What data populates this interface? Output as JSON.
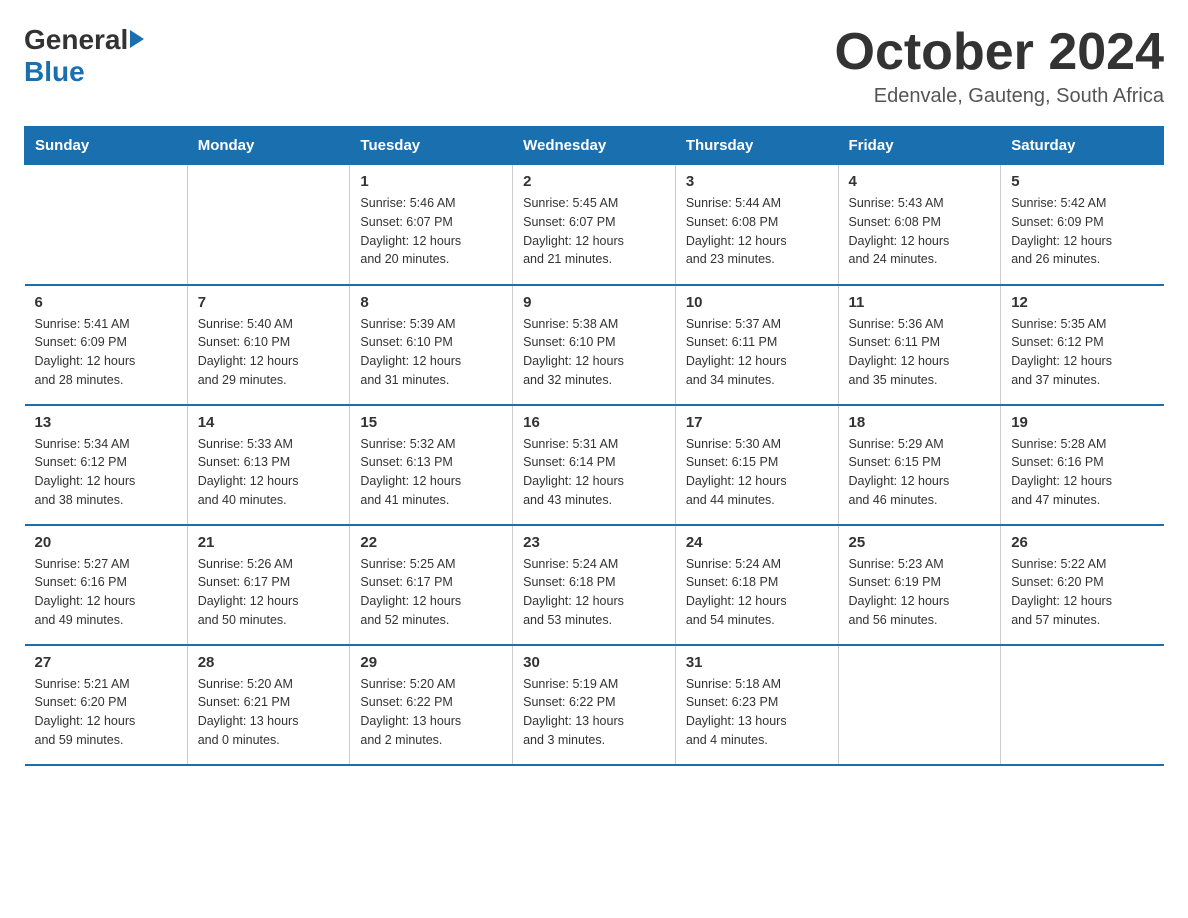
{
  "header": {
    "logo_general": "General",
    "logo_blue": "Blue",
    "month_title": "October 2024",
    "location": "Edenvale, Gauteng, South Africa"
  },
  "calendar": {
    "days_of_week": [
      "Sunday",
      "Monday",
      "Tuesday",
      "Wednesday",
      "Thursday",
      "Friday",
      "Saturday"
    ],
    "weeks": [
      [
        {
          "day": "",
          "info": ""
        },
        {
          "day": "",
          "info": ""
        },
        {
          "day": "1",
          "info": "Sunrise: 5:46 AM\nSunset: 6:07 PM\nDaylight: 12 hours\nand 20 minutes."
        },
        {
          "day": "2",
          "info": "Sunrise: 5:45 AM\nSunset: 6:07 PM\nDaylight: 12 hours\nand 21 minutes."
        },
        {
          "day": "3",
          "info": "Sunrise: 5:44 AM\nSunset: 6:08 PM\nDaylight: 12 hours\nand 23 minutes."
        },
        {
          "day": "4",
          "info": "Sunrise: 5:43 AM\nSunset: 6:08 PM\nDaylight: 12 hours\nand 24 minutes."
        },
        {
          "day": "5",
          "info": "Sunrise: 5:42 AM\nSunset: 6:09 PM\nDaylight: 12 hours\nand 26 minutes."
        }
      ],
      [
        {
          "day": "6",
          "info": "Sunrise: 5:41 AM\nSunset: 6:09 PM\nDaylight: 12 hours\nand 28 minutes."
        },
        {
          "day": "7",
          "info": "Sunrise: 5:40 AM\nSunset: 6:10 PM\nDaylight: 12 hours\nand 29 minutes."
        },
        {
          "day": "8",
          "info": "Sunrise: 5:39 AM\nSunset: 6:10 PM\nDaylight: 12 hours\nand 31 minutes."
        },
        {
          "day": "9",
          "info": "Sunrise: 5:38 AM\nSunset: 6:10 PM\nDaylight: 12 hours\nand 32 minutes."
        },
        {
          "day": "10",
          "info": "Sunrise: 5:37 AM\nSunset: 6:11 PM\nDaylight: 12 hours\nand 34 minutes."
        },
        {
          "day": "11",
          "info": "Sunrise: 5:36 AM\nSunset: 6:11 PM\nDaylight: 12 hours\nand 35 minutes."
        },
        {
          "day": "12",
          "info": "Sunrise: 5:35 AM\nSunset: 6:12 PM\nDaylight: 12 hours\nand 37 minutes."
        }
      ],
      [
        {
          "day": "13",
          "info": "Sunrise: 5:34 AM\nSunset: 6:12 PM\nDaylight: 12 hours\nand 38 minutes."
        },
        {
          "day": "14",
          "info": "Sunrise: 5:33 AM\nSunset: 6:13 PM\nDaylight: 12 hours\nand 40 minutes."
        },
        {
          "day": "15",
          "info": "Sunrise: 5:32 AM\nSunset: 6:13 PM\nDaylight: 12 hours\nand 41 minutes."
        },
        {
          "day": "16",
          "info": "Sunrise: 5:31 AM\nSunset: 6:14 PM\nDaylight: 12 hours\nand 43 minutes."
        },
        {
          "day": "17",
          "info": "Sunrise: 5:30 AM\nSunset: 6:15 PM\nDaylight: 12 hours\nand 44 minutes."
        },
        {
          "day": "18",
          "info": "Sunrise: 5:29 AM\nSunset: 6:15 PM\nDaylight: 12 hours\nand 46 minutes."
        },
        {
          "day": "19",
          "info": "Sunrise: 5:28 AM\nSunset: 6:16 PM\nDaylight: 12 hours\nand 47 minutes."
        }
      ],
      [
        {
          "day": "20",
          "info": "Sunrise: 5:27 AM\nSunset: 6:16 PM\nDaylight: 12 hours\nand 49 minutes."
        },
        {
          "day": "21",
          "info": "Sunrise: 5:26 AM\nSunset: 6:17 PM\nDaylight: 12 hours\nand 50 minutes."
        },
        {
          "day": "22",
          "info": "Sunrise: 5:25 AM\nSunset: 6:17 PM\nDaylight: 12 hours\nand 52 minutes."
        },
        {
          "day": "23",
          "info": "Sunrise: 5:24 AM\nSunset: 6:18 PM\nDaylight: 12 hours\nand 53 minutes."
        },
        {
          "day": "24",
          "info": "Sunrise: 5:24 AM\nSunset: 6:18 PM\nDaylight: 12 hours\nand 54 minutes."
        },
        {
          "day": "25",
          "info": "Sunrise: 5:23 AM\nSunset: 6:19 PM\nDaylight: 12 hours\nand 56 minutes."
        },
        {
          "day": "26",
          "info": "Sunrise: 5:22 AM\nSunset: 6:20 PM\nDaylight: 12 hours\nand 57 minutes."
        }
      ],
      [
        {
          "day": "27",
          "info": "Sunrise: 5:21 AM\nSunset: 6:20 PM\nDaylight: 12 hours\nand 59 minutes."
        },
        {
          "day": "28",
          "info": "Sunrise: 5:20 AM\nSunset: 6:21 PM\nDaylight: 13 hours\nand 0 minutes."
        },
        {
          "day": "29",
          "info": "Sunrise: 5:20 AM\nSunset: 6:22 PM\nDaylight: 13 hours\nand 2 minutes."
        },
        {
          "day": "30",
          "info": "Sunrise: 5:19 AM\nSunset: 6:22 PM\nDaylight: 13 hours\nand 3 minutes."
        },
        {
          "day": "31",
          "info": "Sunrise: 5:18 AM\nSunset: 6:23 PM\nDaylight: 13 hours\nand 4 minutes."
        },
        {
          "day": "",
          "info": ""
        },
        {
          "day": "",
          "info": ""
        }
      ]
    ]
  },
  "colors": {
    "header_bg": "#1a6faf",
    "header_text": "#ffffff",
    "border": "#1a6faf",
    "text": "#333333"
  }
}
